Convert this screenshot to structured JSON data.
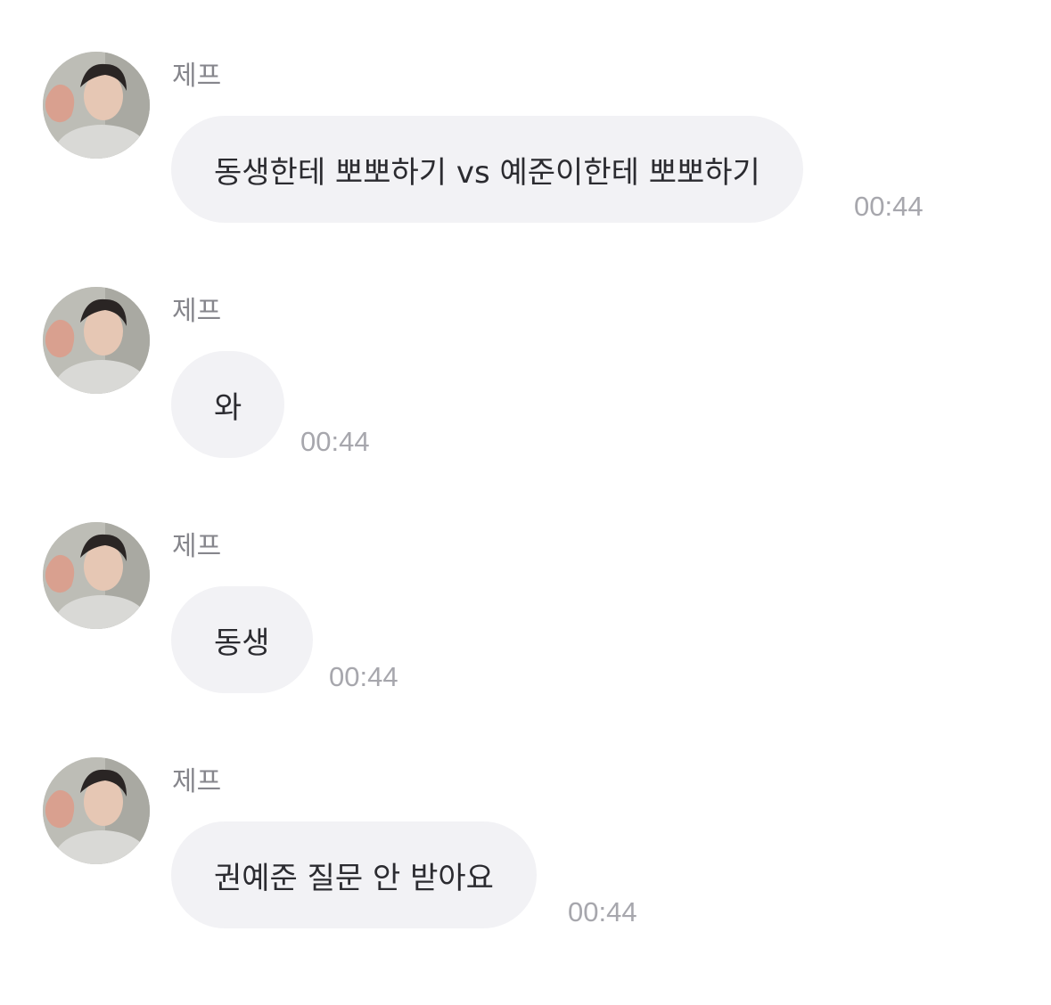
{
  "messages": [
    {
      "sender": "제프",
      "text": "동생한테 뽀뽀하기 vs 예준이한테 뽀뽀하기",
      "time": "00:44"
    },
    {
      "sender": "제프",
      "text": "와",
      "time": "00:44"
    },
    {
      "sender": "제프",
      "text": "동생",
      "time": "00:44"
    },
    {
      "sender": "제프",
      "text": "권예준 질문 안 받아요",
      "time": "00:44"
    }
  ],
  "colors": {
    "bubble": "#f2f2f5",
    "sender": "#86868c",
    "time": "#a7a7ad",
    "text": "#2b2b30"
  }
}
